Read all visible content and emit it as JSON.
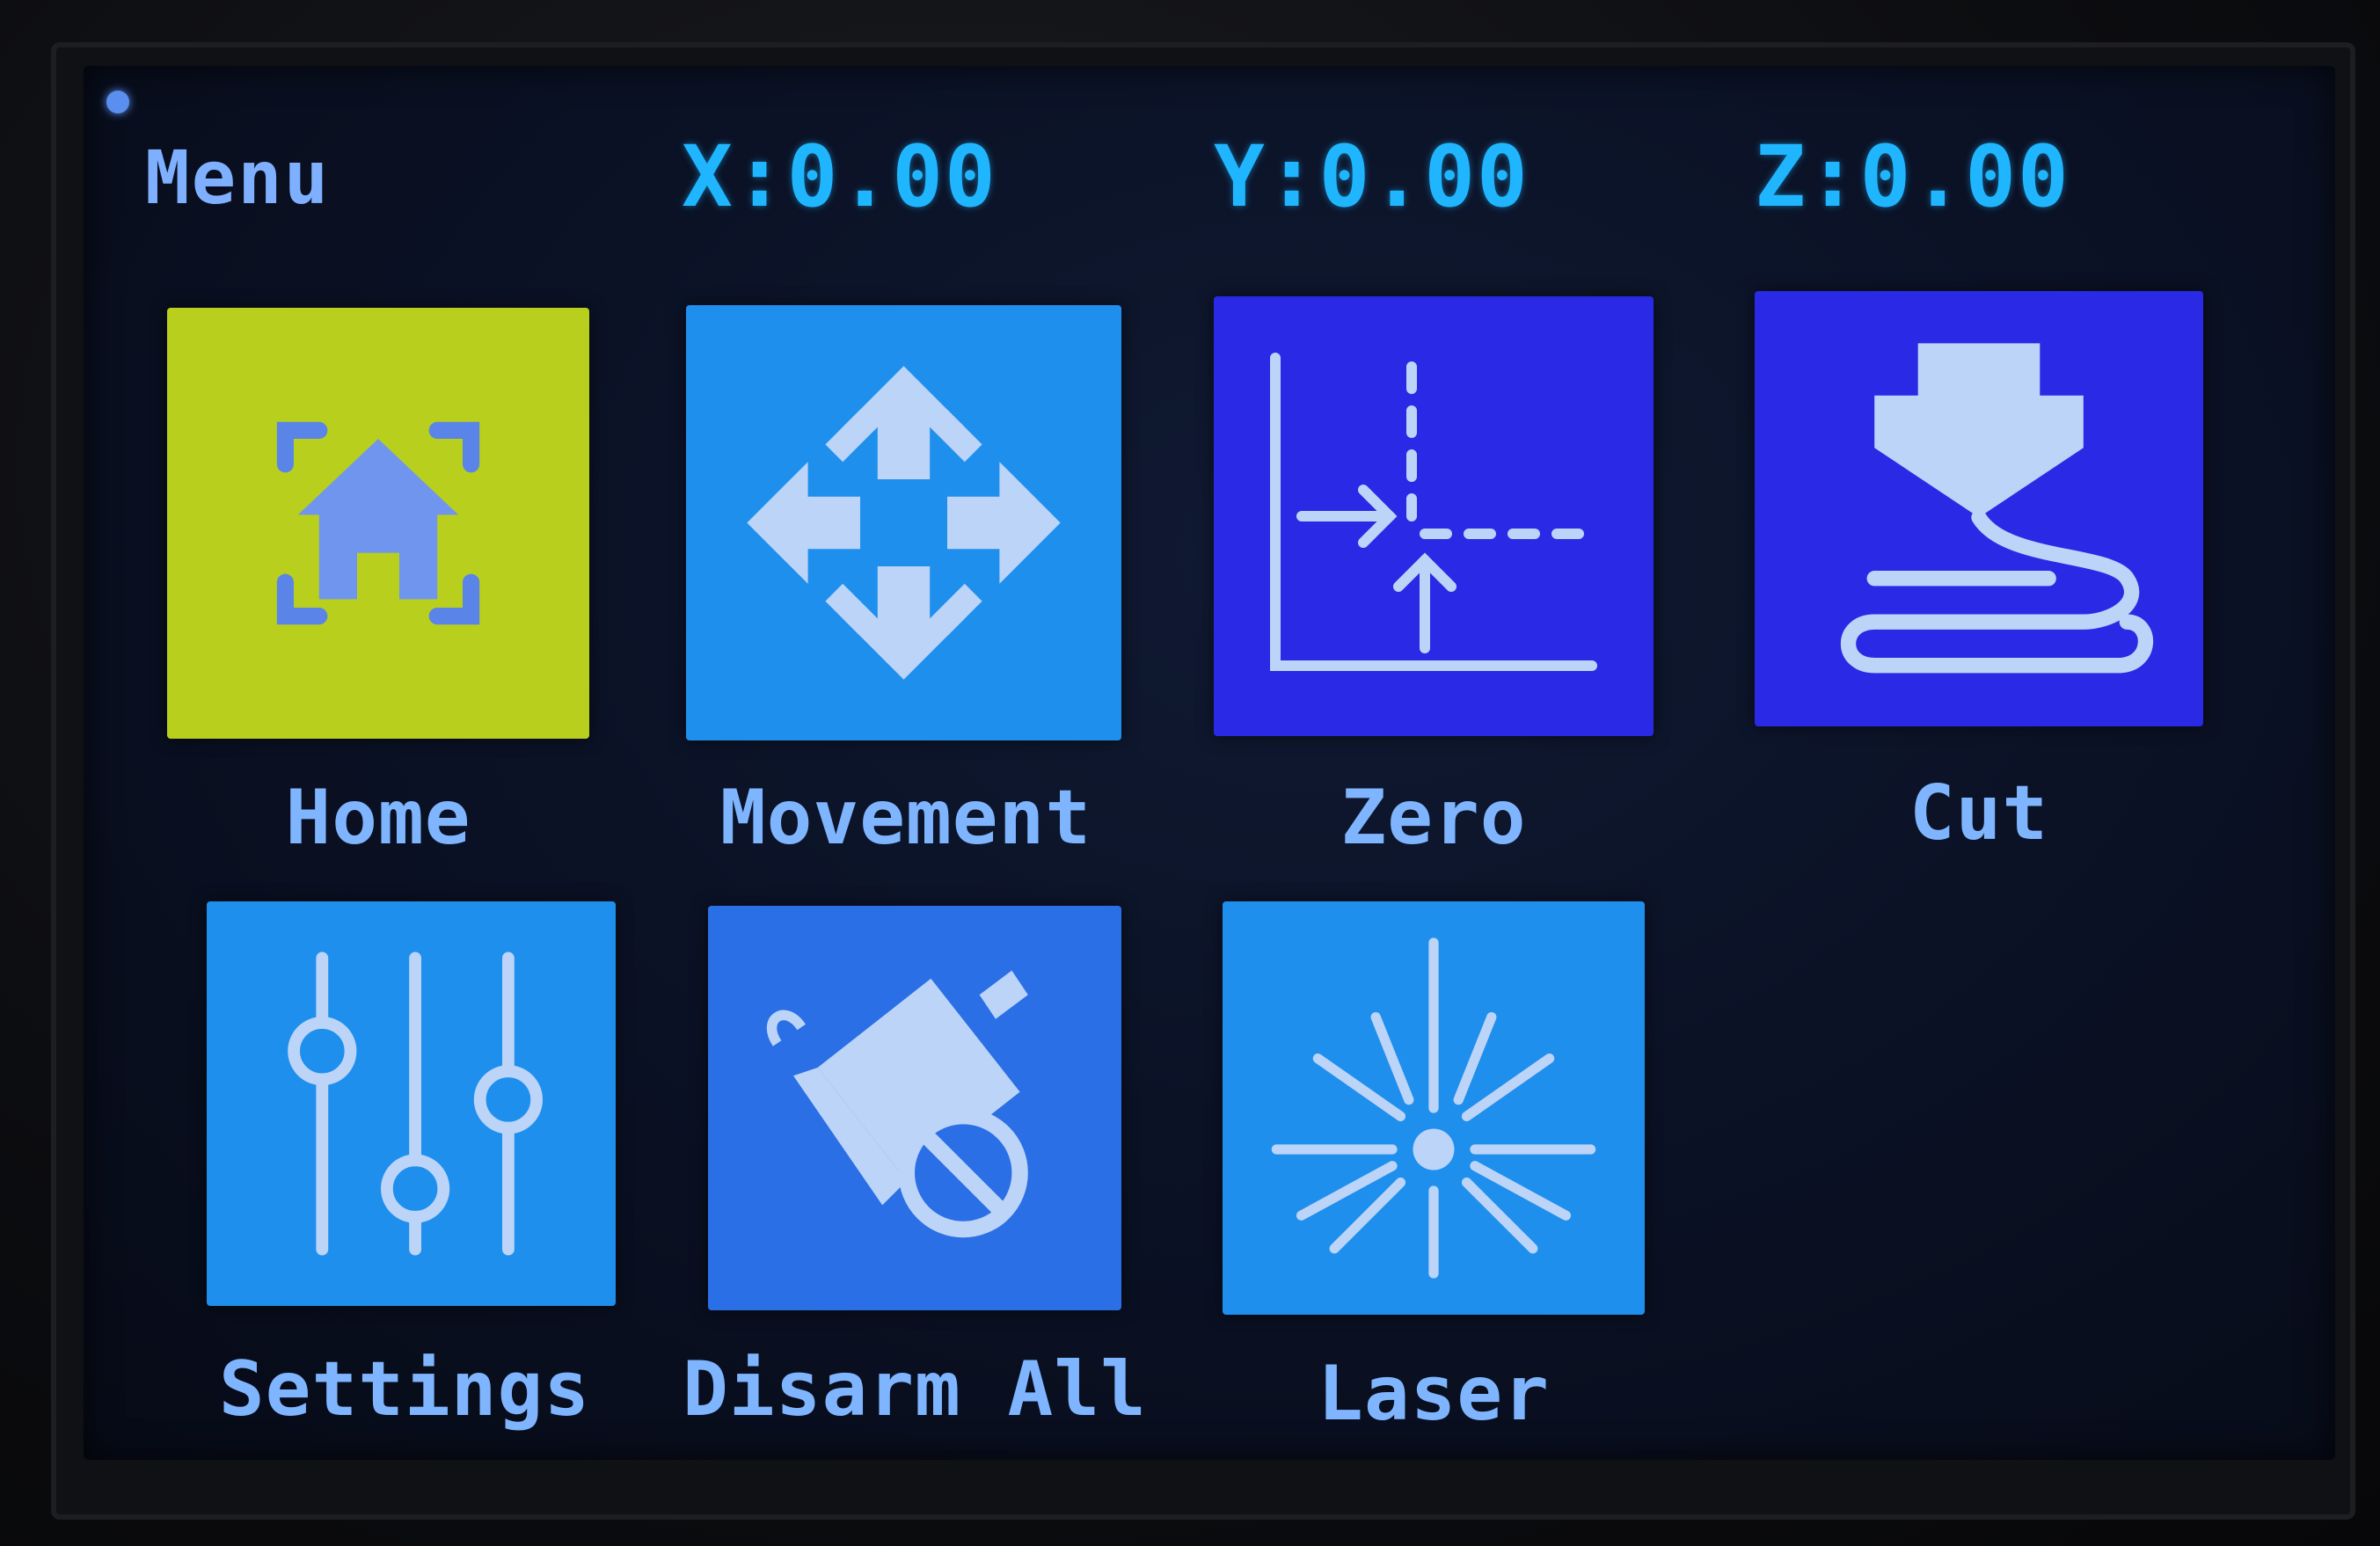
{
  "header": {
    "title": "Menu",
    "x": "X:0.00",
    "y": "Y:0.00",
    "z": "Z:0.00"
  },
  "tiles": [
    {
      "label": "Home",
      "color": "#b9cf1e",
      "icon": "home-icon"
    },
    {
      "label": "Movement",
      "color": "#1f8fee",
      "icon": "move-arrows-icon"
    },
    {
      "label": "Zero",
      "color": "#2a2ae6",
      "icon": "zero-axis-icon"
    },
    {
      "label": "Cut",
      "color": "#2a2ae6",
      "icon": "cut-extrude-icon"
    },
    {
      "label": "Settings",
      "color": "#1f8fee",
      "icon": "sliders-icon"
    },
    {
      "label": "Disarm All",
      "color": "#2b6fe6",
      "icon": "motor-disable-icon"
    },
    {
      "label": "Laser",
      "color": "#1f8fee",
      "icon": "laser-icon"
    }
  ],
  "colors": {
    "label": "#7fb5ff",
    "coord": "#1fb6ff",
    "icon": "#bcd4f7"
  }
}
